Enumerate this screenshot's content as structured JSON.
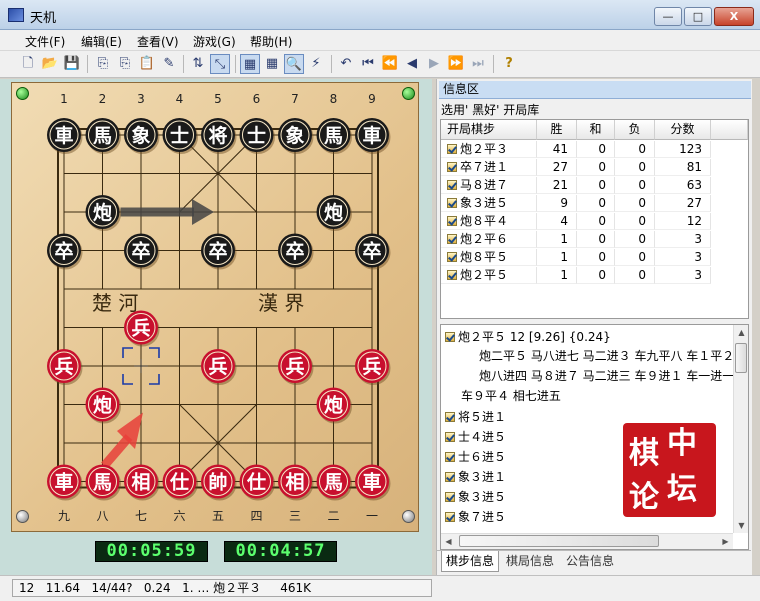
{
  "window": {
    "title": "天机",
    "min_label": "—",
    "max_label": "□",
    "close_label": "X"
  },
  "menu": [
    "文件(F)",
    "编辑(E)",
    "查看(V)",
    "游戏(G)",
    "帮助(H)"
  ],
  "toolbar": [
    "🗋",
    "📂",
    "💾",
    "⎘",
    "⎘",
    "📋",
    "✎",
    "⇅",
    "⤡",
    "▦",
    "▦",
    "🔍",
    "⚡",
    "↶",
    "⏮",
    "⏪",
    "◀",
    "▶",
    "⏩",
    "⏭",
    "?"
  ],
  "board": {
    "top_numbers": [
      "1",
      "2",
      "3",
      "4",
      "5",
      "6",
      "7",
      "8",
      "9"
    ],
    "bottom_numbers": [
      "九",
      "八",
      "七",
      "六",
      "五",
      "四",
      "三",
      "二",
      "一"
    ],
    "river_left": "楚  河",
    "river_right": "漢  界",
    "black_pieces": [
      {
        "label": "車",
        "file": 0,
        "rank": 0
      },
      {
        "label": "馬",
        "file": 1,
        "rank": 0
      },
      {
        "label": "象",
        "file": 2,
        "rank": 0
      },
      {
        "label": "士",
        "file": 3,
        "rank": 0
      },
      {
        "label": "将",
        "file": 4,
        "rank": 0
      },
      {
        "label": "士",
        "file": 5,
        "rank": 0
      },
      {
        "label": "象",
        "file": 6,
        "rank": 0
      },
      {
        "label": "馬",
        "file": 7,
        "rank": 0
      },
      {
        "label": "車",
        "file": 8,
        "rank": 0
      },
      {
        "label": "炮",
        "file": 1,
        "rank": 2
      },
      {
        "label": "炮",
        "file": 7,
        "rank": 2
      },
      {
        "label": "卒",
        "file": 0,
        "rank": 3
      },
      {
        "label": "卒",
        "file": 2,
        "rank": 3
      },
      {
        "label": "卒",
        "file": 4,
        "rank": 3
      },
      {
        "label": "卒",
        "file": 6,
        "rank": 3
      },
      {
        "label": "卒",
        "file": 8,
        "rank": 3
      }
    ],
    "red_pieces": [
      {
        "label": "兵",
        "file": 2,
        "rank": 5
      },
      {
        "label": "兵",
        "file": 0,
        "rank": 6
      },
      {
        "label": "兵",
        "file": 4,
        "rank": 6
      },
      {
        "label": "兵",
        "file": 6,
        "rank": 6
      },
      {
        "label": "兵",
        "file": 8,
        "rank": 6
      },
      {
        "label": "炮",
        "file": 1,
        "rank": 7
      },
      {
        "label": "炮",
        "file": 7,
        "rank": 7
      },
      {
        "label": "車",
        "file": 0,
        "rank": 9
      },
      {
        "label": "馬",
        "file": 1,
        "rank": 9
      },
      {
        "label": "相",
        "file": 2,
        "rank": 9
      },
      {
        "label": "仕",
        "file": 3,
        "rank": 9
      },
      {
        "label": "帥",
        "file": 4,
        "rank": 9
      },
      {
        "label": "仕",
        "file": 5,
        "rank": 9
      },
      {
        "label": "相",
        "file": 6,
        "rank": 9
      },
      {
        "label": "馬",
        "file": 7,
        "rank": 9
      },
      {
        "label": "車",
        "file": 8,
        "rank": 9
      }
    ],
    "colors": {
      "black_piece": "#1a1a1a",
      "red_piece": "#c8102e",
      "piece_face": "#f6e7c6",
      "red_arrow": "#e8403a",
      "gray_arrow": "#444444"
    }
  },
  "clocks": {
    "left": "00:05:59",
    "right": "00:04:57"
  },
  "info": {
    "title": "信息区",
    "opening_label": "选用' 黑好' 开局库",
    "columns": [
      "开局棋步",
      "胜",
      "和",
      "负",
      "分数"
    ],
    "rows": [
      [
        "炮２平３",
        "41",
        "0",
        "0",
        "123"
      ],
      [
        "卒７进１",
        "27",
        "0",
        "0",
        "81"
      ],
      [
        "马８进７",
        "21",
        "0",
        "0",
        "63"
      ],
      [
        "象３进５",
        "9",
        "0",
        "0",
        "27"
      ],
      [
        "炮８平４",
        "4",
        "0",
        "0",
        "12"
      ],
      [
        "炮２平６",
        "1",
        "0",
        "0",
        "3"
      ],
      [
        "炮８平５",
        "1",
        "0",
        "0",
        "3"
      ],
      [
        "炮２平５",
        "1",
        "0",
        "0",
        "3"
      ]
    ]
  },
  "moves": {
    "first": "炮２平５   12  [9.26]  {0.24}",
    "pv": [
      "炮二平５ 马八进七 马二进３ 车九平八 车１平２",
      "炮八进四 马８进７ 马二进三 车９进１ 车一进一",
      "车９平４ 相七进五"
    ],
    "list": [
      "将５进１",
      "士４进５",
      "士６进５",
      "象３进１",
      "象３进５",
      "象７进５"
    ],
    "scroll_up": "▲",
    "scroll_down": "▼",
    "scroll_left": "◀",
    "scroll_right": "▶"
  },
  "stamp": [
    "棋",
    "中",
    "论",
    "坛"
  ],
  "tabs": [
    "棋步信息",
    "棋局信息",
    "公告信息"
  ],
  "status": "12   11.64   14/44?   0.24   1. … 炮２平３     461K"
}
